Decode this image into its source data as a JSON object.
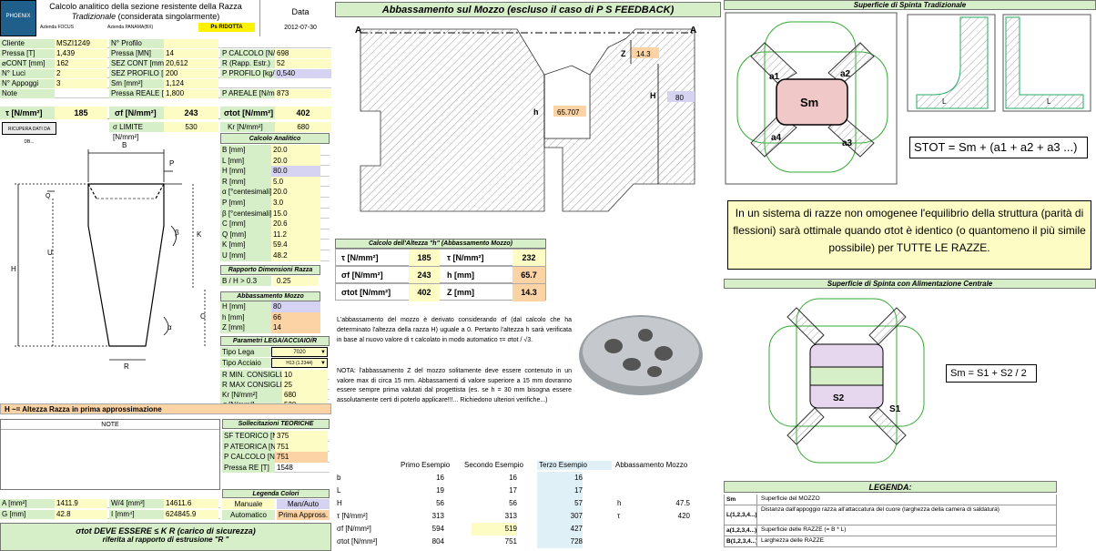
{
  "header": {
    "title_line1": "Calcolo analitico della sezione resistente della Razza",
    "title_line2": "Tradizionale",
    "title_line2b": " (considerata singolarmente)",
    "logo_top": "PHOENIX",
    "azienda_label": "Azienda FOCUS",
    "azienda_right": "Azienda PANAMA(BX)",
    "ps_ridotta": "Ps RIDOTTA",
    "data_label": "Data",
    "data_value": "2012-07-30"
  },
  "info": {
    "cliente_l": "Cliente",
    "cliente_v": "MSZI1249",
    "profilo_l": "N° Profilo",
    "profilo_v": "",
    "pressa_l": "Pressa [T]",
    "pressa_v": "1,439",
    "pressa_mn_l": "Pressa [MN]",
    "pressa_mn_v": "14",
    "pcalc_l": "P CALCOLO [N/mm²]",
    "pcalc_v": "698",
    "dcont_l": "⌀CONT [mm]",
    "dcont_v": "162",
    "scont_l": "SEZ CONT [mm²]",
    "scont_v": "20,612",
    "r_l": "R (Rapp. Estr.)",
    "r_v": "52",
    "luci_l": "N° Luci",
    "luci_v": "2",
    "sprof_l": "SEZ PROFILO [mm²]",
    "sprof_v": "200",
    "pprof_l": "P PROFILO [kg/ml]",
    "pprof_v": "0,540",
    "appoggi_l": "N° Appoggi",
    "appoggi_v": "3",
    "sm_l": "Sm [mm²]",
    "sm_v": "1,124",
    "note_l": "Note",
    "preale_l": "Pressa REALE [T]",
    "preale_v": "1,800",
    "pareale_l": "P AREALE [N/mm²]",
    "pareale_v": "873"
  },
  "stress": {
    "tau_l": "τ [N/mm²]",
    "tau_v": "185",
    "sf_l": "σf [N/mm²]",
    "sf_v": "243",
    "stot_l": "σtot [N/mm²]",
    "stot_v": "402",
    "sigma_lim_l": "σ LIMITE [N/mm²]",
    "sigma_lim_v": "530",
    "kr_l": "Kr [N/mm²]",
    "kr_v": "680",
    "ricupera": "RICUPERA DATI DA DB..."
  },
  "calcolo": {
    "title": "Calcolo Analitico",
    "rows": [
      [
        "B [mm]",
        "20.0"
      ],
      [
        "L [mm]",
        "20.0"
      ],
      [
        "H [mm]",
        "80.0"
      ],
      [
        "R [mm]",
        "5.0"
      ],
      [
        "α [°centesimali]",
        "20.0"
      ],
      [
        "P [mm]",
        "3.0"
      ],
      [
        "β [°centesimali]",
        "15.0"
      ],
      [
        "C [mm]",
        "20.6"
      ],
      [
        "Q [mm]",
        "11.2"
      ],
      [
        "K [mm]",
        "59.4"
      ],
      [
        "U [mm]",
        "48.2"
      ]
    ]
  },
  "rapporto": {
    "title": "Rapporto Dimensioni Razza",
    "label": "B / H > 0.3",
    "value": "0.25"
  },
  "abbassamento": {
    "title": "Abbassamento Mozzo",
    "rows": [
      [
        "H [mm]",
        "80"
      ],
      [
        "h [mm]",
        "66"
      ],
      [
        "Z [mm]",
        "14"
      ]
    ]
  },
  "parametri": {
    "title": "Parametri LEGA/ACCIAIO/R",
    "tipo_lega_l": "Tipo Lega",
    "tipo_lega_v": "7020",
    "tipo_acc_l": "Tipo Acciaio",
    "tipo_acc_v": "H13 (1.2344)",
    "rows": [
      [
        "R MIN. CONSIGLIATO",
        "10"
      ],
      [
        "R MAX CONSIGLIATO",
        "25"
      ],
      [
        "Kr [N/mm²]",
        "680"
      ],
      [
        "σ [N/mm²]",
        "530"
      ]
    ]
  },
  "drawing": {
    "B": "B",
    "P": "P",
    "Q": "Q",
    "beta": "β",
    "K": "K",
    "U": "U",
    "H": "H",
    "C": "C",
    "alpha": "α",
    "R": "R"
  },
  "h_note": "H ~= Altezza Razza in prima approssimazione",
  "note_title": "NOTE",
  "sollec": {
    "title": "Sollecitazioni TEORICHE",
    "rows": [
      [
        "SF TEORICO [N/mm²]",
        "375"
      ],
      [
        "P ATEORICA [N/mm²]",
        "751"
      ],
      [
        "P CALCOLO [N/mm²]",
        "751"
      ],
      [
        "Pressa RE [T]",
        "1548"
      ]
    ]
  },
  "bottom": {
    "a_l": "A [mm²]",
    "a_v": "1411.9",
    "w_l": "W/4 [mm³]",
    "w_v": "14611.6",
    "g_l": "G [mm]",
    "g_v": "42.8",
    "i_l": "I [mm⁴]",
    "i_v": "624845.9"
  },
  "legenda_colori": {
    "title": "Legenda Colori",
    "manuale": "Manuale",
    "man_auto": "Man/Auto",
    "automatico": "Automatico",
    "prima": "Prima Appross."
  },
  "warning": {
    "line1": "σtot DEVE ESSERE ≤ K R (carico di sicurezza)",
    "line2": "riferita al rapporto di estrusione \"R \""
  },
  "mid": {
    "title": "Abbassamento sul Mozzo (escluso il caso di P S FEEDBACK)",
    "A_left": "A",
    "A_right": "A",
    "Z": "Z",
    "z_val": "14.3",
    "H": "H",
    "H_val": "80",
    "h": "h",
    "h_val": "65.707",
    "calc_title": "Calcolo dell'Altezza \"h\" (Abbassamento Mozzo)",
    "calc_rows": [
      [
        "τ [N/mm²]",
        "185",
        "τ [N/mm²]",
        "232"
      ],
      [
        "σf [N/mm²]",
        "243",
        "h [mm]",
        "65.7"
      ],
      [
        "σtot [N/mm²]",
        "402",
        "Z [mm]",
        "14.3"
      ]
    ],
    "para1": "L'abbassamento del mozzo è derivato considerando σf (dal calcolo che ha determinato l'altezza della razza H) uguale a 0. Pertanto l'altezza h sarà verificata in base al nuovo valore di τ calcolato in modo automatico τ= σtot / √3.",
    "para2": "NOTA: l'abbassamento Z del mozzo solitamente deve essere contenuto in un valore max di circa 15 mm. Abbassamenti di valore superiore a 15 mm dovranno essere sempre prima valutati dal progettista (es. se h = 30 mm bisogna essere assolutamente certi di poterlo applicare!!!... Richiedono ulteriori verifiche...)",
    "ex_headers": [
      "Primo Esempio",
      "Secondo Esempio",
      "Terzo Esempio",
      "Abbassamento Mozzo"
    ],
    "ex_rows": [
      [
        "b",
        "16",
        "16",
        "16",
        "",
        ""
      ],
      [
        "L",
        "19",
        "17",
        "17",
        "",
        ""
      ],
      [
        "H",
        "56",
        "56",
        "57",
        "h",
        "47.5"
      ],
      [
        "τ [N/mm²]",
        "313",
        "313",
        "307",
        "τ",
        "420"
      ],
      [
        "σf [N/mm²]",
        "594",
        "519",
        "427",
        "",
        ""
      ],
      [
        "σtot [N/mm²]",
        "804",
        "751",
        "728",
        "",
        ""
      ]
    ]
  },
  "right": {
    "title_top": "Superficie di Spinta Tradizionale",
    "sm": "Sm",
    "a1": "a1",
    "a2": "a2",
    "a3": "a3",
    "a4": "a4",
    "L_lbl": "L",
    "formula": "STOT = Sm + (a1 + a2 + a3 ...)",
    "box_text": "In un sistema di razze non omogenee l'equilibrio della struttura (parità di flessioni) sarà ottimale quando σtot è identico (o quantomeno il più simile possibile) per TUTTE LE RAZZE.",
    "title_central": "Superficie di Spinta con Alimentazione Centrale",
    "s1": "S1",
    "s2": "S2",
    "formula2": "Sm = S1 + S2 / 2",
    "legenda_title": "LEGENDA:",
    "legenda": [
      [
        "Sm",
        "Superficie del MOZZO"
      ],
      [
        "L(1,2,3,4...)",
        "Distanza dall'appoggio razza all'attaccatura del cuore (larghezza della camera di saldatura)"
      ],
      [
        "a(1,2,3,4...)",
        "Superficie delle RAZZE (= B * L)"
      ],
      [
        "B(1,2,3,4...)",
        "Larghezza delle RAZZE"
      ]
    ]
  },
  "colors": {
    "green": "#d6efc9",
    "yellow": "#fdfcc4",
    "orange": "#fbd3a4",
    "purple": "#d6d3f2"
  }
}
